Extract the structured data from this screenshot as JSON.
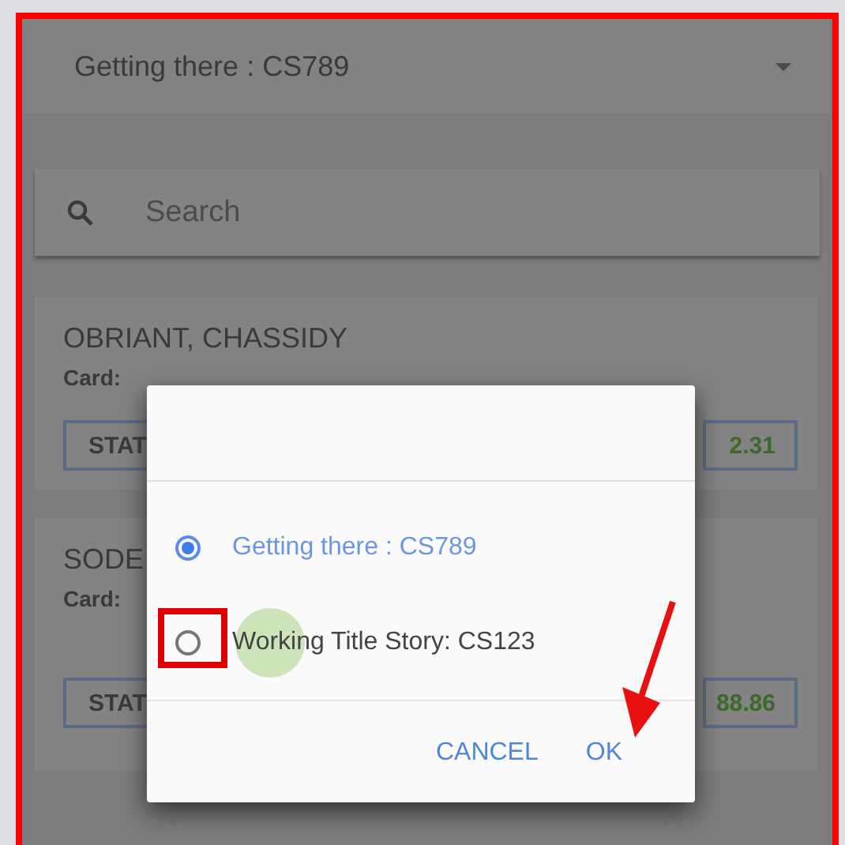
{
  "selector": {
    "value": "Getting there : CS789"
  },
  "search": {
    "placeholder": "Search"
  },
  "cards": [
    {
      "name": "OBRIANT, CHASSIDY",
      "card_label": "Card:",
      "status": "STAT",
      "amount": "2.31"
    },
    {
      "name": "SODE",
      "card_label": "Card:",
      "status": "STAT",
      "amount": "88.86"
    }
  ],
  "dialog": {
    "options": [
      {
        "label": "Getting there : CS789",
        "selected": true
      },
      {
        "label": "Working Title Story: CS123",
        "selected": false
      }
    ],
    "buttons": [
      "CANCEL",
      "OK"
    ]
  }
}
